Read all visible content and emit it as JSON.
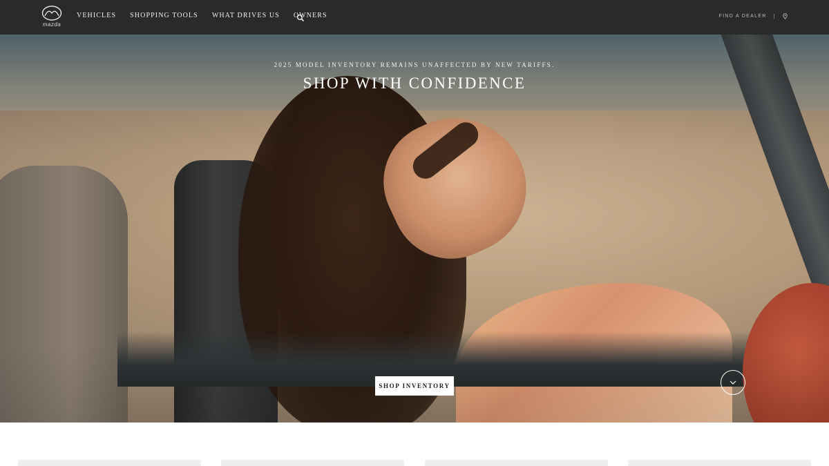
{
  "nav": {
    "logo_word": "mazda",
    "items": [
      {
        "label": "VEHICLES"
      },
      {
        "label": "SHOPPING TOOLS"
      },
      {
        "label": "WHAT DRIVES US"
      },
      {
        "label": "OWNERS"
      }
    ],
    "search_icon": "search-icon",
    "find_dealer": "FIND A DEALER",
    "separator": "|",
    "location_icon": "location-pin-icon"
  },
  "hero": {
    "subtitle": "2025 MODEL INVENTORY REMAINS UNAFFECTED BY NEW TARIFFS.",
    "title": "SHOP WITH CONFIDENCE",
    "cta_label": "SHOP INVENTORY",
    "scroll_icon": "chevron-down-icon"
  },
  "colors": {
    "nav_bg": "#2a2a2a",
    "cta_bg": "#ffffff",
    "cta_text": "#1a1a1a"
  }
}
